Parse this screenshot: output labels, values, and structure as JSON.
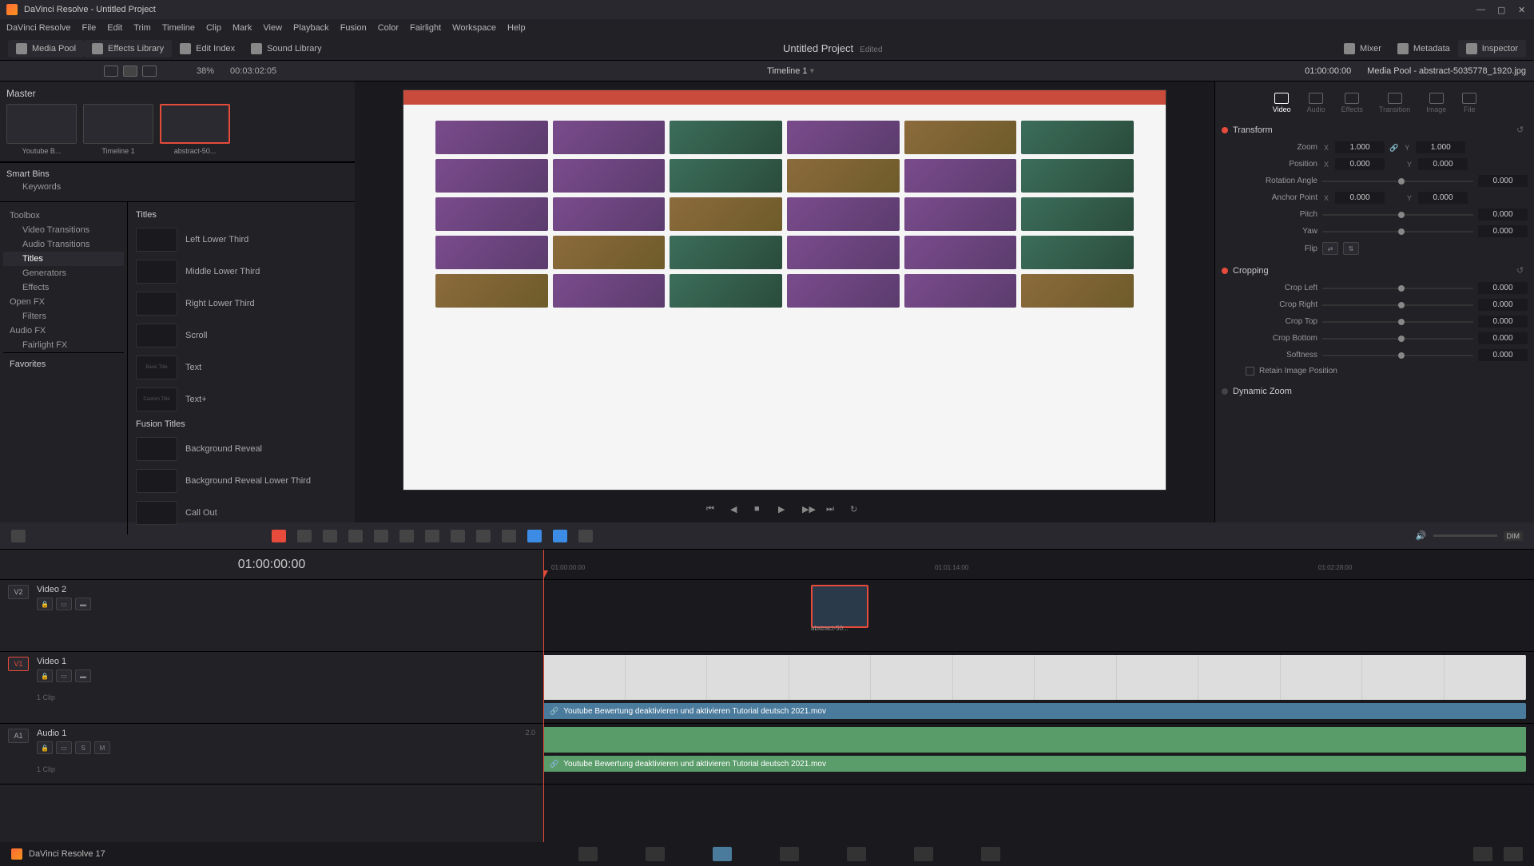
{
  "titlebar": {
    "title": "DaVinci Resolve - Untitled Project"
  },
  "menubar": [
    "DaVinci Resolve",
    "File",
    "Edit",
    "Trim",
    "Timeline",
    "Clip",
    "Mark",
    "View",
    "Playback",
    "Fusion",
    "Color",
    "Fairlight",
    "Workspace",
    "Help"
  ],
  "toolbar": {
    "media_pool": "Media Pool",
    "effects_library": "Effects Library",
    "edit_index": "Edit Index",
    "sound_library": "Sound Library",
    "mixer": "Mixer",
    "metadata": "Metadata",
    "inspector": "Inspector"
  },
  "project": {
    "title": "Untitled Project",
    "status": "Edited"
  },
  "subbar": {
    "zoom": "38%",
    "tc": "00:03:02:05",
    "timeline": "Timeline 1",
    "tc_right": "01:00:00:00",
    "inspector_title": "Media Pool - abstract-5035778_1920.jpg"
  },
  "media_pool": {
    "master": "Master",
    "clips": [
      {
        "name": "Youtube B..."
      },
      {
        "name": "Timeline 1"
      },
      {
        "name": "abstract-50..."
      }
    ],
    "smart_bins": "Smart Bins",
    "keywords": "Keywords"
  },
  "fx": {
    "tree": [
      {
        "label": "Toolbox",
        "indent": false
      },
      {
        "label": "Video Transitions",
        "indent": true
      },
      {
        "label": "Audio Transitions",
        "indent": true
      },
      {
        "label": "Titles",
        "indent": true,
        "active": true
      },
      {
        "label": "Generators",
        "indent": true
      },
      {
        "label": "Effects",
        "indent": true
      },
      {
        "label": "Open FX",
        "indent": false
      },
      {
        "label": "Filters",
        "indent": true
      },
      {
        "label": "Audio FX",
        "indent": false
      },
      {
        "label": "Fairlight FX",
        "indent": true
      }
    ],
    "titles_section": "Titles",
    "titles": [
      "Left Lower Third",
      "Middle Lower Third",
      "Right Lower Third",
      "Scroll",
      "Text",
      "Text+"
    ],
    "fusion_section": "Fusion Titles",
    "fusion": [
      "Background Reveal",
      "Background Reveal Lower Third",
      "Call Out"
    ],
    "favorites": "Favorites"
  },
  "inspector": {
    "tabs": [
      "Video",
      "Audio",
      "Effects",
      "Transition",
      "Image",
      "File"
    ],
    "transform": {
      "title": "Transform",
      "zoom": "Zoom",
      "zoom_x": "1.000",
      "zoom_y": "1.000",
      "position": "Position",
      "pos_x": "0.000",
      "pos_y": "0.000",
      "rotation": "Rotation Angle",
      "rot_val": "0.000",
      "anchor": "Anchor Point",
      "anc_x": "0.000",
      "anc_y": "0.000",
      "pitch": "Pitch",
      "pitch_val": "0.000",
      "yaw": "Yaw",
      "yaw_val": "0.000",
      "flip": "Flip"
    },
    "cropping": {
      "title": "Cropping",
      "left": "Crop Left",
      "left_val": "0.000",
      "right": "Crop Right",
      "right_val": "0.000",
      "top": "Crop Top",
      "top_val": "0.000",
      "bottom": "Crop Bottom",
      "bottom_val": "0.000",
      "softness": "Softness",
      "soft_val": "0.000",
      "retain": "Retain Image Position"
    },
    "dynamic_zoom": "Dynamic Zoom"
  },
  "timeline": {
    "tc": "01:00:00:00",
    "ruler": [
      "01:00:00:00",
      "01:01:14:00",
      "01:02:28:00"
    ],
    "v2": {
      "tag": "V2",
      "name": "Video 2",
      "clip_label": "abstract-50..."
    },
    "v1": {
      "tag": "V1",
      "name": "Video 1",
      "clips": "1 Clip",
      "clip_label": "Youtube Bewertung deaktivieren und aktivieren Tutorial deutsch 2021.mov"
    },
    "a1": {
      "tag": "A1",
      "name": "Audio 1",
      "ch": "2.0",
      "clips": "1 Clip",
      "clip_label": "Youtube Bewertung deaktivieren und aktivieren Tutorial deutsch 2021.mov"
    },
    "dim": "DIM"
  },
  "bottombar": {
    "version": "DaVinci Resolve 17"
  }
}
